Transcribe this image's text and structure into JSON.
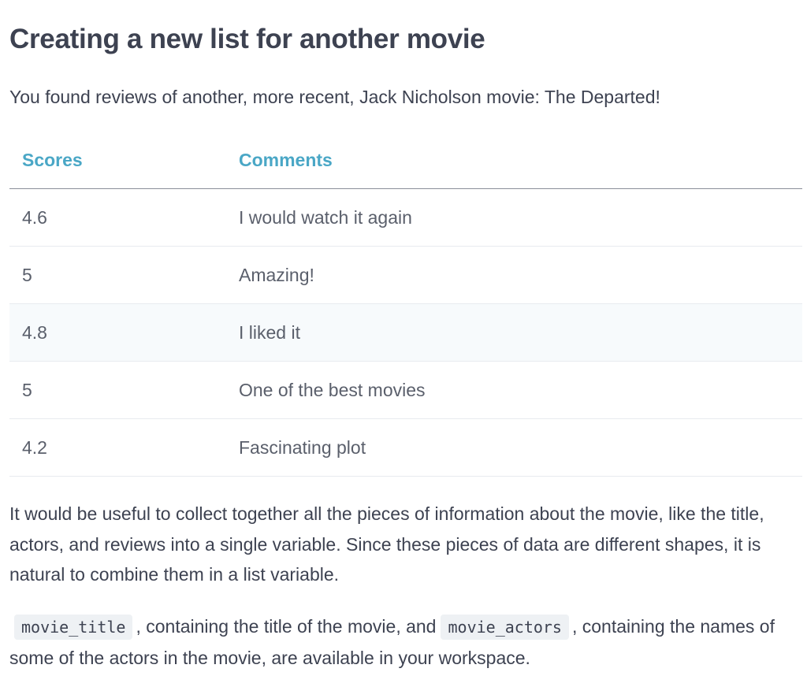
{
  "heading": "Creating a new list for another movie",
  "intro": "You found reviews of another, more recent, Jack Nicholson movie: The Departed!",
  "table": {
    "headers": [
      "Scores",
      "Comments"
    ],
    "rows": [
      {
        "score": "4.6",
        "comment": "I would watch it again"
      },
      {
        "score": "5",
        "comment": "Amazing!"
      },
      {
        "score": "4.8",
        "comment": "I liked it"
      },
      {
        "score": "5",
        "comment": "One of the best movies"
      },
      {
        "score": "4.2",
        "comment": "Fascinating plot"
      }
    ]
  },
  "paragraph1": "It would be useful to collect together all the pieces of information about the movie, like the title, actors, and reviews into a single variable. Since these pieces of data are different shapes, it is natural to combine them in a list variable.",
  "paragraph2": {
    "code1": "movie_title",
    "text1": ", containing the title of the movie, and",
    "code2": "movie_actors",
    "text2": ", containing the names of some of the actors in the movie, are available in your workspace."
  },
  "colors": {
    "header_accent": "#4aa7c6",
    "text": "#3d4251",
    "row_highlight": "#f7fafc",
    "code_bg": "#eef1f4"
  }
}
